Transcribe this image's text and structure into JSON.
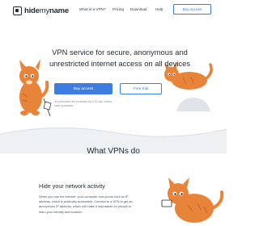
{
  "header": {
    "logo_brand": "hide",
    "logo_brand_tail": "my",
    "logo_name": "name",
    "nav": [
      "What is a VPN?",
      "Pricing",
      "Download",
      "Help"
    ],
    "cta": "Buy access"
  },
  "hero": {
    "title": "VPN service for secure, anonymous and unrestricted internet access on all devices",
    "buy_button": "Buy access",
    "free_button": "Free trial",
    "guarantee": "All purchases are protected by a 30-day money-back guarantee"
  },
  "section": {
    "title": "What VPNs do"
  },
  "feature": {
    "title": "Hide your network activity",
    "body": "When you use the internet, your computer and phone hold an IP address, which is publically accessible. Connect to a VPN to get an anonymous IP address, which will make it impossible for people to learn your identity and location."
  },
  "colors": {
    "accent": "#3d7de0",
    "cat": "#e8833a",
    "wave": "#eef1f4"
  }
}
